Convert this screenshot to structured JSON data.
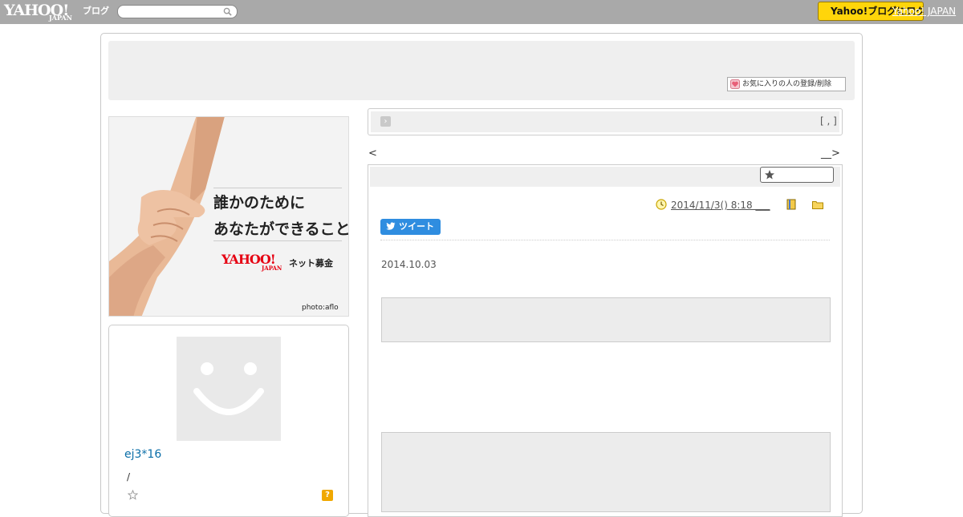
{
  "topbar": {
    "logo_text": "YAHOO!",
    "logo_sub": "JAPAN",
    "logo_blog": "ブログ",
    "search_placeholder": "",
    "yahoo_button_label": "Yahoo!ブログにログイン",
    "japan_link": "Yahoo! JAPAN"
  },
  "header": {
    "favorite_button_label": "お気に入りの人の登録/削除"
  },
  "banner": {
    "line1": "誰かのために",
    "line2": "あなたができること",
    "brand": "YAHOO!",
    "brand_sub": "JAPAN",
    "service": "ネット募金",
    "credit": "photo:aflo"
  },
  "profile": {
    "username": "ej3*16",
    "slash_text": "/",
    "help_icon_text": "?"
  },
  "crumb": {
    "count_text": "[ , ]"
  },
  "nav": {
    "prev_label": "<",
    "next_label": "__>"
  },
  "article": {
    "post_date": "2014/11/3()  8:18 ___",
    "tweet_label": "ツイート",
    "body_date": "2014.10.03"
  },
  "colors": {
    "topbar": "#a9a9a9",
    "accent_yellow": "#ffd50a",
    "link_blue": "#0a6ea8",
    "tweet_blue": "#2f8de0",
    "panel_grey": "#efefef"
  },
  "icons": [
    "search-icon",
    "heart-icon",
    "chevron-right-icon",
    "star-icon",
    "clock-icon",
    "book-icon",
    "folder-icon",
    "bird-icon",
    "help-icon"
  ]
}
